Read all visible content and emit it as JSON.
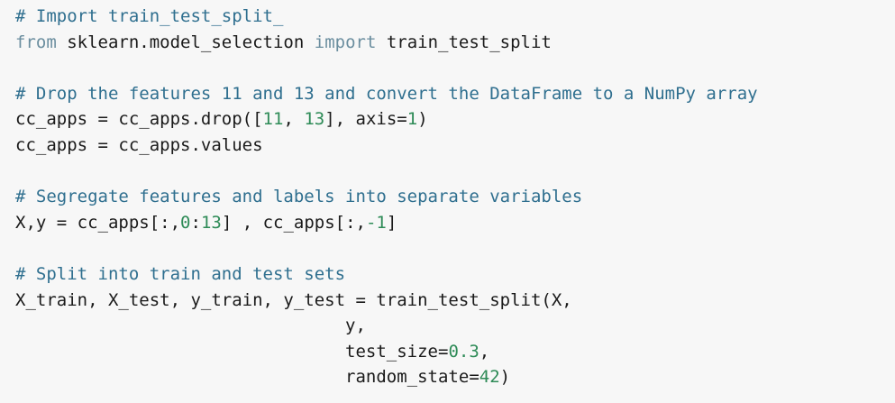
{
  "code": {
    "lines": [
      [
        {
          "t": "c",
          "v": "# Import train_test_split_"
        }
      ],
      [
        {
          "t": "k",
          "v": "from"
        },
        {
          "t": "p",
          "v": " sklearn.model_selection "
        },
        {
          "t": "k",
          "v": "import"
        },
        {
          "t": "p",
          "v": " train_test_split"
        }
      ],
      [],
      [
        {
          "t": "c",
          "v": "# Drop the features 11 and 13 and convert the DataFrame to a NumPy array"
        }
      ],
      [
        {
          "t": "p",
          "v": "cc_apps = cc_apps.drop(["
        },
        {
          "t": "n",
          "v": "11"
        },
        {
          "t": "p",
          "v": ", "
        },
        {
          "t": "n",
          "v": "13"
        },
        {
          "t": "p",
          "v": "], axis="
        },
        {
          "t": "n",
          "v": "1"
        },
        {
          "t": "p",
          "v": ")"
        }
      ],
      [
        {
          "t": "p",
          "v": "cc_apps = cc_apps.values"
        }
      ],
      [],
      [
        {
          "t": "c",
          "v": "# Segregate features and labels into separate variables"
        }
      ],
      [
        {
          "t": "p",
          "v": "X,y = cc_apps[:,"
        },
        {
          "t": "n",
          "v": "0"
        },
        {
          "t": "p",
          "v": ":"
        },
        {
          "t": "n",
          "v": "13"
        },
        {
          "t": "p",
          "v": "] , cc_apps[:,"
        },
        {
          "t": "n",
          "v": "-1"
        },
        {
          "t": "p",
          "v": "]"
        }
      ],
      [],
      [
        {
          "t": "c",
          "v": "# Split into train and test sets"
        }
      ],
      [
        {
          "t": "p",
          "v": "X_train, X_test, y_train, y_test = train_test_split(X,"
        }
      ],
      [
        {
          "t": "p",
          "v": "                                y,"
        }
      ],
      [
        {
          "t": "p",
          "v": "                                test_size="
        },
        {
          "t": "n",
          "v": "0.3"
        },
        {
          "t": "p",
          "v": ","
        }
      ],
      [
        {
          "t": "p",
          "v": "                                random_state="
        },
        {
          "t": "n",
          "v": "42"
        },
        {
          "t": "p",
          "v": ")"
        }
      ]
    ]
  },
  "colors": {
    "background": "#f7f7f7",
    "comment": "#2f6f8f",
    "keyword": "#6b8e9f",
    "number": "#2e8b57",
    "text": "#1a1a1a"
  }
}
